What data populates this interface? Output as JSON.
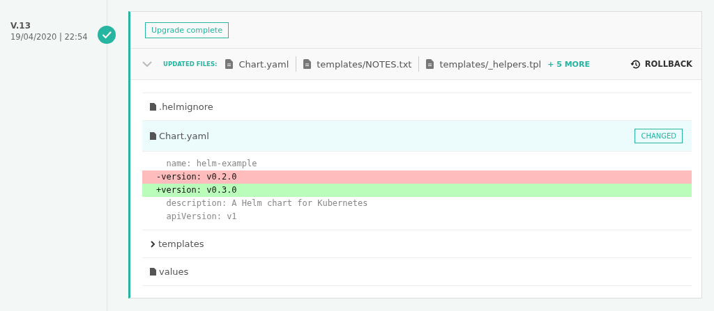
{
  "release": {
    "version": "V.13",
    "date": "19/04/2020 | 22:54",
    "done": true
  },
  "status_badge": "Upgrade complete",
  "updated_files": {
    "label": "UPDATED FILES:",
    "expanded": true,
    "files": [
      "Chart.yaml",
      "templates/NOTES.txt",
      "templates/_helpers.tpl"
    ],
    "more": "+ 5 MORE"
  },
  "rollback": "ROLLBACK",
  "tree": [
    {
      "kind": "file",
      "name": ".helmignore",
      "selected": false
    },
    {
      "kind": "file",
      "name": "Chart.yaml",
      "selected": true,
      "badge": "CHANGED",
      "diff": [
        {
          "kind": "context",
          "text": "  name: helm-example"
        },
        {
          "kind": "removed",
          "text": "-version: v0.2.0"
        },
        {
          "kind": "added",
          "text": "+version: v0.3.0"
        },
        {
          "kind": "context",
          "text": "  description: A Helm chart for Kubernetes"
        },
        {
          "kind": "context",
          "text": "  apiVersion: v1"
        }
      ]
    },
    {
      "kind": "folder",
      "name": "templates",
      "expanded": false
    },
    {
      "kind": "file",
      "name": "values",
      "selected": false
    }
  ]
}
